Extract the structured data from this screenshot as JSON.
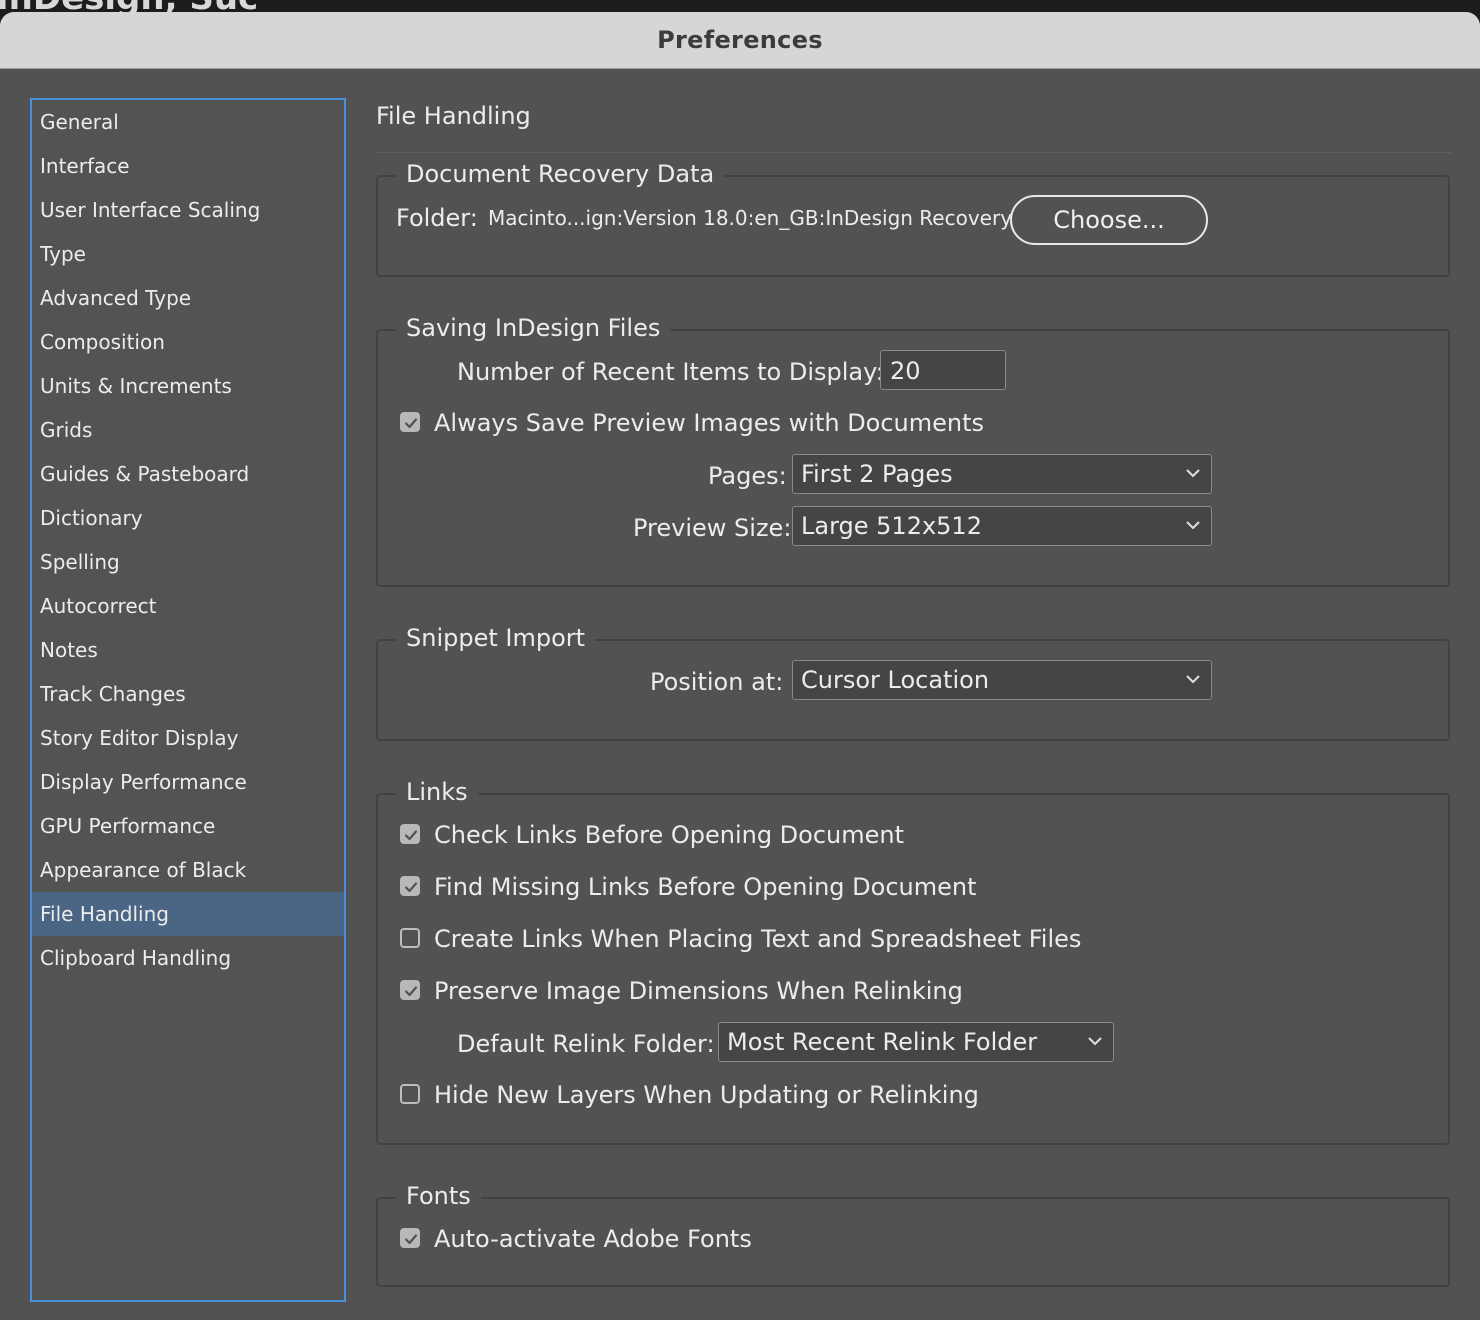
{
  "background_app_title": "InDesign, Suc",
  "window": {
    "title": "Preferences"
  },
  "sidebar": {
    "items": [
      {
        "label": "General"
      },
      {
        "label": "Interface"
      },
      {
        "label": "User Interface Scaling"
      },
      {
        "label": "Type"
      },
      {
        "label": "Advanced Type"
      },
      {
        "label": "Composition"
      },
      {
        "label": "Units & Increments"
      },
      {
        "label": "Grids"
      },
      {
        "label": "Guides & Pasteboard"
      },
      {
        "label": "Dictionary"
      },
      {
        "label": "Spelling"
      },
      {
        "label": "Autocorrect"
      },
      {
        "label": "Notes"
      },
      {
        "label": "Track Changes"
      },
      {
        "label": "Story Editor Display"
      },
      {
        "label": "Display Performance"
      },
      {
        "label": "GPU Performance"
      },
      {
        "label": "Appearance of Black"
      },
      {
        "label": "File Handling"
      },
      {
        "label": "Clipboard Handling"
      }
    ],
    "selected": "File Handling"
  },
  "main": {
    "title": "File Handling",
    "recovery": {
      "group_title": "Document Recovery Data",
      "folder_label": "Folder:",
      "folder_path": "Macinto...ign:Version 18.0:en_GB:InDesign Recovery",
      "choose_label": "Choose..."
    },
    "saving": {
      "group_title": "Saving InDesign Files",
      "recent_label": "Number of Recent Items to Display:",
      "recent_value": "20",
      "always_save_label": "Always Save Preview Images with Documents",
      "always_save_checked": true,
      "pages_label": "Pages:",
      "pages_value": "First 2 Pages",
      "preview_size_label": "Preview Size:",
      "preview_size_value": "Large 512x512"
    },
    "snippet": {
      "group_title": "Snippet Import",
      "position_label": "Position at:",
      "position_value": "Cursor Location"
    },
    "links": {
      "group_title": "Links",
      "check_links_label": "Check Links Before Opening Document",
      "check_links_checked": true,
      "find_missing_label": "Find Missing Links Before Opening Document",
      "find_missing_checked": true,
      "create_links_label": "Create Links When Placing Text and Spreadsheet Files",
      "create_links_checked": false,
      "preserve_dims_label": "Preserve Image Dimensions When Relinking",
      "preserve_dims_checked": true,
      "relink_folder_label": "Default Relink Folder:",
      "relink_folder_value": "Most Recent Relink Folder",
      "hide_layers_label": "Hide New Layers When Updating or Relinking",
      "hide_layers_checked": false
    },
    "fonts": {
      "group_title": "Fonts",
      "auto_activate_label": "Auto-activate Adobe Fonts",
      "auto_activate_checked": true
    }
  },
  "colors": {
    "dialog_bg": "#525252",
    "titlebar_bg": "#d6d6d6",
    "selection_bg": "#4b6584",
    "focus_ring": "#4a90d9"
  }
}
